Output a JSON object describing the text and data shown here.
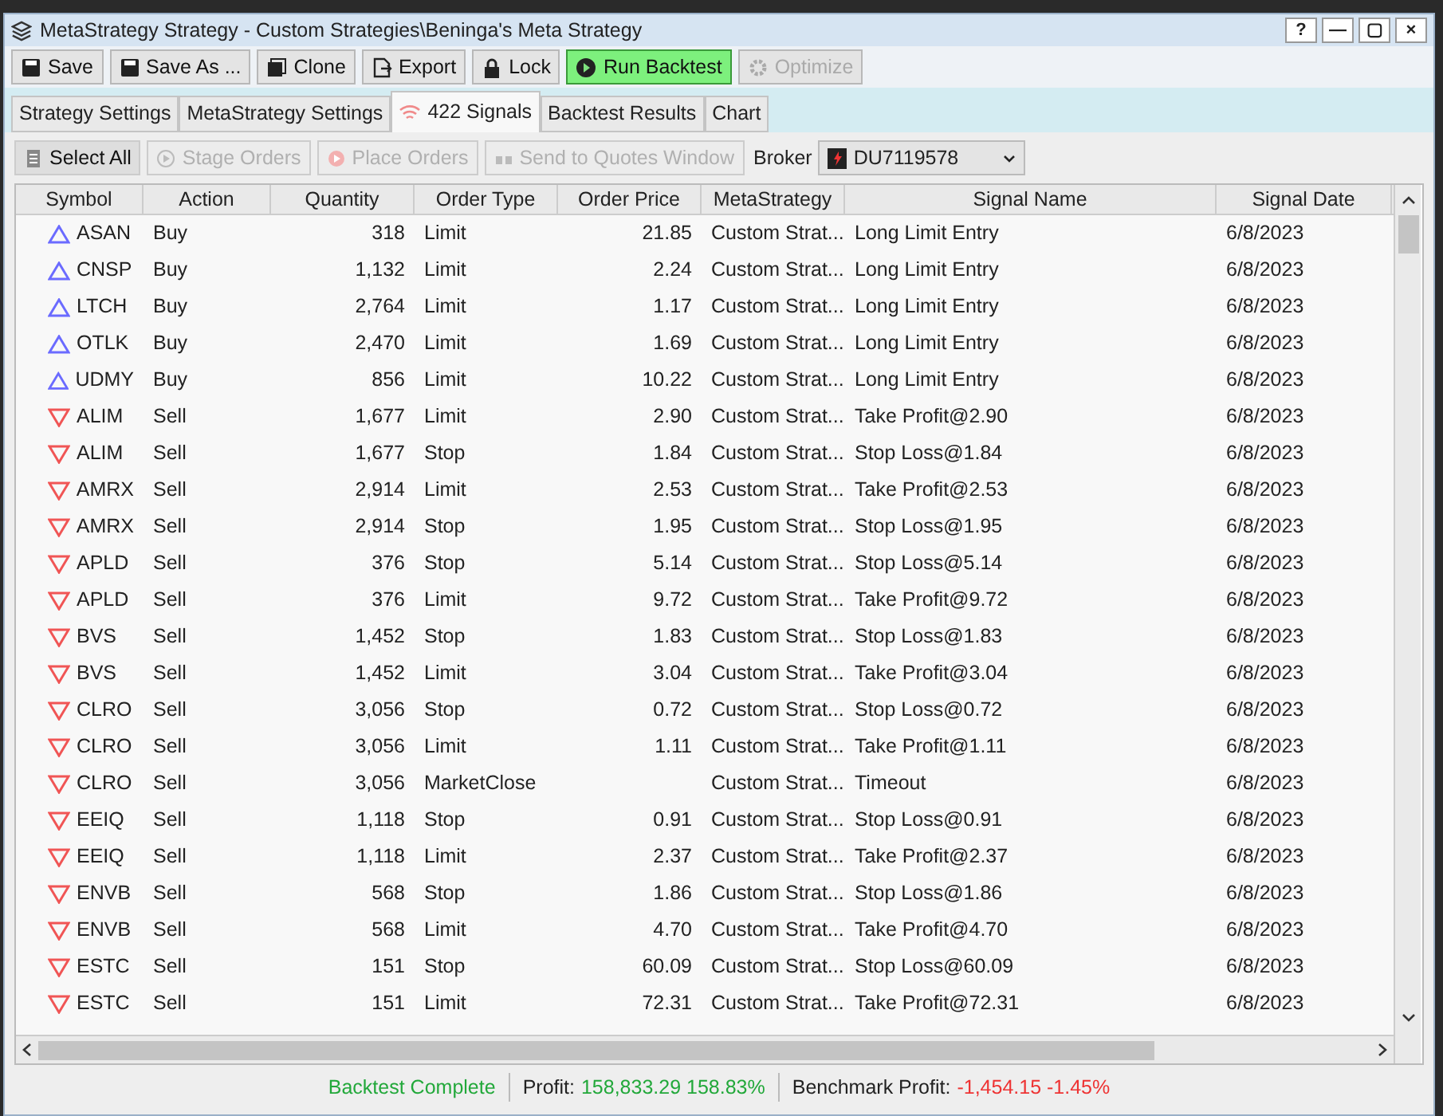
{
  "window": {
    "title": "MetaStrategy Strategy - Custom Strategies\\Beninga's Meta Strategy",
    "controls": [
      "?",
      "—",
      "▢",
      "×"
    ]
  },
  "toolbar": [
    {
      "label": "Save",
      "kind": "normal",
      "disabled": false
    },
    {
      "label": "Save As ...",
      "kind": "normal",
      "disabled": false
    },
    {
      "label": "Clone",
      "kind": "normal",
      "disabled": false
    },
    {
      "label": "Export",
      "kind": "normal",
      "disabled": false
    },
    {
      "label": "Lock",
      "kind": "normal",
      "disabled": false
    },
    {
      "label": "Run Backtest",
      "kind": "primary",
      "disabled": false
    },
    {
      "label": "Optimize",
      "kind": "normal",
      "disabled": true
    }
  ],
  "tabs": [
    {
      "label": "Strategy Settings",
      "selected": false
    },
    {
      "label": "MetaStrategy Settings",
      "selected": false
    },
    {
      "label": "422 Signals",
      "selected": true
    },
    {
      "label": "Backtest Results",
      "selected": false
    },
    {
      "label": "Chart",
      "selected": false
    }
  ],
  "actions": [
    {
      "label": "Select All",
      "disabled": false
    },
    {
      "label": "Stage Orders",
      "disabled": true
    },
    {
      "label": "Place Orders",
      "disabled": true
    },
    {
      "label": "Send to Quotes Window",
      "disabled": true
    }
  ],
  "broker": {
    "label": "Broker",
    "value": "DU7119578"
  },
  "table": {
    "columns": [
      "Symbol",
      "Action",
      "Quantity",
      "Order Type",
      "Order Price",
      "MetaStrategy",
      "Signal Name",
      "Signal Date"
    ],
    "rows": [
      {
        "kind": "buy",
        "cells": [
          "ASAN",
          "Buy",
          "318",
          "Limit",
          "21.85",
          "Custom Strat...",
          "Long Limit Entry",
          "6/8/2023"
        ]
      },
      {
        "kind": "buy",
        "cells": [
          "CNSP",
          "Buy",
          "1,132",
          "Limit",
          "2.24",
          "Custom Strat...",
          "Long Limit Entry",
          "6/8/2023"
        ]
      },
      {
        "kind": "buy",
        "cells": [
          "LTCH",
          "Buy",
          "2,764",
          "Limit",
          "1.17",
          "Custom Strat...",
          "Long Limit Entry",
          "6/8/2023"
        ]
      },
      {
        "kind": "buy",
        "cells": [
          "OTLK",
          "Buy",
          "2,470",
          "Limit",
          "1.69",
          "Custom Strat...",
          "Long Limit Entry",
          "6/8/2023"
        ]
      },
      {
        "kind": "buy",
        "cells": [
          "UDMY",
          "Buy",
          "856",
          "Limit",
          "10.22",
          "Custom Strat...",
          "Long Limit Entry",
          "6/8/2023"
        ]
      },
      {
        "kind": "sell",
        "cells": [
          "ALIM",
          "Sell",
          "1,677",
          "Limit",
          "2.90",
          "Custom Strat...",
          "Take Profit@2.90",
          "6/8/2023"
        ]
      },
      {
        "kind": "sell",
        "cells": [
          "ALIM",
          "Sell",
          "1,677",
          "Stop",
          "1.84",
          "Custom Strat...",
          "Stop Loss@1.84",
          "6/8/2023"
        ]
      },
      {
        "kind": "sell",
        "cells": [
          "AMRX",
          "Sell",
          "2,914",
          "Limit",
          "2.53",
          "Custom Strat...",
          "Take Profit@2.53",
          "6/8/2023"
        ]
      },
      {
        "kind": "sell",
        "cells": [
          "AMRX",
          "Sell",
          "2,914",
          "Stop",
          "1.95",
          "Custom Strat...",
          "Stop Loss@1.95",
          "6/8/2023"
        ]
      },
      {
        "kind": "sell",
        "cells": [
          "APLD",
          "Sell",
          "376",
          "Stop",
          "5.14",
          "Custom Strat...",
          "Stop Loss@5.14",
          "6/8/2023"
        ]
      },
      {
        "kind": "sell",
        "cells": [
          "APLD",
          "Sell",
          "376",
          "Limit",
          "9.72",
          "Custom Strat...",
          "Take Profit@9.72",
          "6/8/2023"
        ]
      },
      {
        "kind": "sell",
        "cells": [
          "BVS",
          "Sell",
          "1,452",
          "Stop",
          "1.83",
          "Custom Strat...",
          "Stop Loss@1.83",
          "6/8/2023"
        ]
      },
      {
        "kind": "sell",
        "cells": [
          "BVS",
          "Sell",
          "1,452",
          "Limit",
          "3.04",
          "Custom Strat...",
          "Take Profit@3.04",
          "6/8/2023"
        ]
      },
      {
        "kind": "sell",
        "cells": [
          "CLRO",
          "Sell",
          "3,056",
          "Stop",
          "0.72",
          "Custom Strat...",
          "Stop Loss@0.72",
          "6/8/2023"
        ]
      },
      {
        "kind": "sell",
        "cells": [
          "CLRO",
          "Sell",
          "3,056",
          "Limit",
          "1.11",
          "Custom Strat...",
          "Take Profit@1.11",
          "6/8/2023"
        ]
      },
      {
        "kind": "sell",
        "cells": [
          "CLRO",
          "Sell",
          "3,056",
          "MarketClose",
          "",
          "Custom Strat...",
          "Timeout",
          "6/8/2023"
        ]
      },
      {
        "kind": "sell",
        "cells": [
          "EEIQ",
          "Sell",
          "1,118",
          "Stop",
          "0.91",
          "Custom Strat...",
          "Stop Loss@0.91",
          "6/8/2023"
        ]
      },
      {
        "kind": "sell",
        "cells": [
          "EEIQ",
          "Sell",
          "1,118",
          "Limit",
          "2.37",
          "Custom Strat...",
          "Take Profit@2.37",
          "6/8/2023"
        ]
      },
      {
        "kind": "sell",
        "cells": [
          "ENVB",
          "Sell",
          "568",
          "Stop",
          "1.86",
          "Custom Strat...",
          "Stop Loss@1.86",
          "6/8/2023"
        ]
      },
      {
        "kind": "sell",
        "cells": [
          "ENVB",
          "Sell",
          "568",
          "Limit",
          "4.70",
          "Custom Strat...",
          "Take Profit@4.70",
          "6/8/2023"
        ]
      },
      {
        "kind": "sell",
        "cells": [
          "ESTC",
          "Sell",
          "151",
          "Stop",
          "60.09",
          "Custom Strat...",
          "Stop Loss@60.09",
          "6/8/2023"
        ]
      },
      {
        "kind": "sell",
        "cells": [
          "ESTC",
          "Sell",
          "151",
          "Limit",
          "72.31",
          "Custom Strat...",
          "Take Profit@72.31",
          "6/8/2023"
        ]
      }
    ]
  },
  "status_bar": [
    {
      "value": "Backtest Complete",
      "color": "#22a83a"
    },
    {
      "label": "Profit:",
      "value": "158,833.29 158.83%",
      "color": "#22a83a"
    },
    {
      "label": "Benchmark Profit:",
      "value": "-1,454.15 -1.45%",
      "color": "#ee3333"
    }
  ]
}
